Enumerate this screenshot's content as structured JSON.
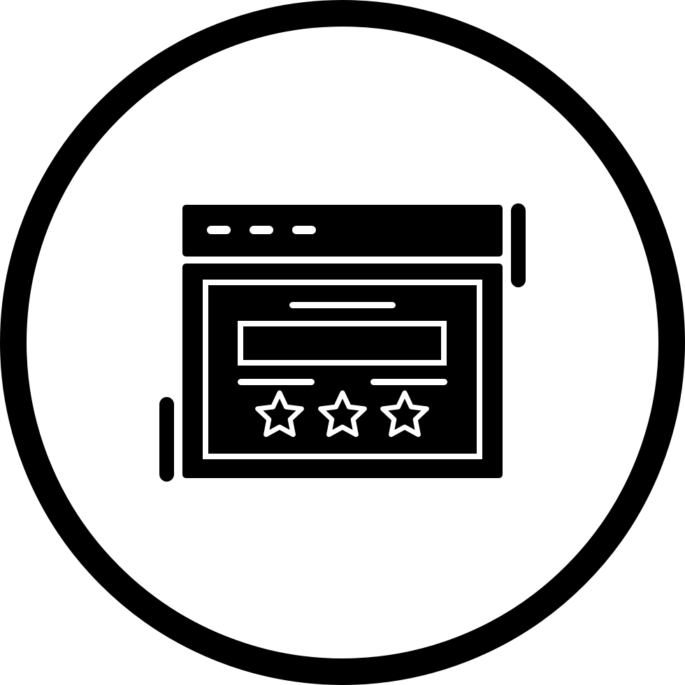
{
  "icon": {
    "name": "website-rating-icon",
    "colors": {
      "foreground": "#000000",
      "background": "#ffffff"
    },
    "window": {
      "title_dot_count": 3
    },
    "rating": {
      "filled_stars": 0,
      "total_stars": 3
    }
  }
}
